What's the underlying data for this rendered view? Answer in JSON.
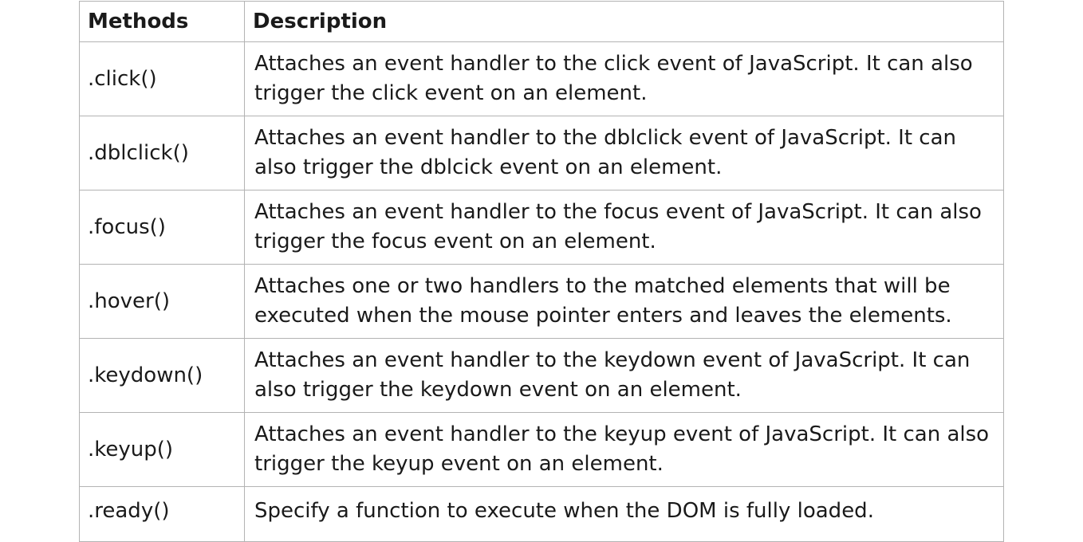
{
  "table": {
    "headers": {
      "method": "Methods",
      "description": "Description"
    },
    "rows": [
      {
        "method": ".click()",
        "description": "Attaches an event handler to the click event of JavaScript. It can also trigger the click event on an element."
      },
      {
        "method": ".dblclick()",
        "description": "Attaches an event handler to the dblclick event of JavaScript. It can also trigger the dblcick event on an element."
      },
      {
        "method": ".focus()",
        "description": "Attaches an event handler to the focus event of JavaScript. It can also trigger the focus event on an element."
      },
      {
        "method": ".hover()",
        "description": "Attaches one or two handlers to the matched elements that will be executed when the mouse pointer enters and leaves the elements."
      },
      {
        "method": ".keydown()",
        "description": "Attaches an event handler to the keydown event of JavaScript. It can also trigger the keydown event on an element."
      },
      {
        "method": ".keyup()",
        "description": "Attaches an event handler to the keyup event of JavaScript. It can also trigger the keyup event on an element."
      },
      {
        "method": ".ready()",
        "description": "Specify a function to execute when the DOM is fully loaded."
      }
    ]
  }
}
